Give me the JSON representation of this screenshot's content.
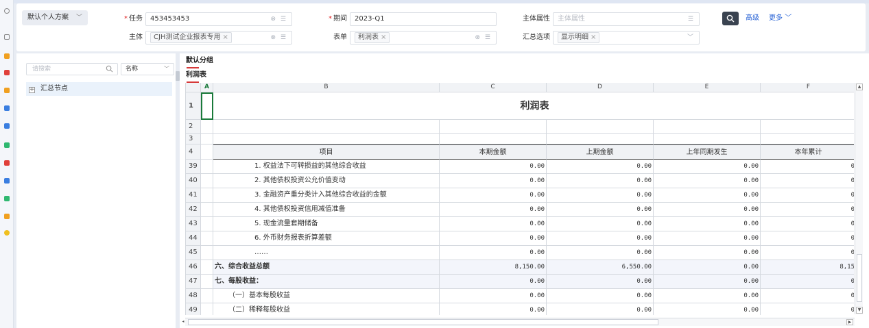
{
  "scheme": {
    "label": "默认个人方案"
  },
  "filters": {
    "task": {
      "label": "任务",
      "value": "453453453"
    },
    "period": {
      "label": "期间",
      "value": "2023-Q1"
    },
    "entity_attr": {
      "label": "主体属性",
      "placeholder": "主体属性"
    },
    "entity": {
      "label": "主体",
      "tag": "CJH测试企业报表专用"
    },
    "form": {
      "label": "表单",
      "tag": "利润表"
    },
    "summary": {
      "label": "汇总选项",
      "tag": "显示明细"
    }
  },
  "actions": {
    "advanced": "高级",
    "more": "更多"
  },
  "sidebar": {
    "search_placeholder": "请搜索",
    "select_value": "名称",
    "tree_root": "汇总节点"
  },
  "tabs": {
    "group": "默认分组",
    "sheet": "利润表"
  },
  "grid": {
    "columns": [
      "A",
      "B",
      "C",
      "D",
      "E",
      "F"
    ],
    "title": "利润表",
    "headers": [
      "项目",
      "本期金额",
      "上期金额",
      "上年同期发生",
      "本年累计"
    ],
    "top_rows": [
      "1",
      "2",
      "3",
      "4"
    ],
    "rows": [
      {
        "n": "39",
        "item": "1. 权益法下可转损益的其他综合收益",
        "c": "0.00",
        "d": "0.00",
        "e": "0.00",
        "f": "0"
      },
      {
        "n": "40",
        "item": "2. 其他债权投资公允价值变动",
        "c": "0.00",
        "d": "0.00",
        "e": "0.00",
        "f": "0"
      },
      {
        "n": "41",
        "item": "3. 金融资产重分类计入其他综合收益的金额",
        "c": "0.00",
        "d": "0.00",
        "e": "0.00",
        "f": "0"
      },
      {
        "n": "42",
        "item": "4. 其他债权投资信用减值准备",
        "c": "0.00",
        "d": "0.00",
        "e": "0.00",
        "f": "0"
      },
      {
        "n": "43",
        "item": "5. 现金流量套期储备",
        "c": "0.00",
        "d": "0.00",
        "e": "0.00",
        "f": "0"
      },
      {
        "n": "44",
        "item": "6. 外币财务报表折算差额",
        "c": "0.00",
        "d": "0.00",
        "e": "0.00",
        "f": "0"
      },
      {
        "n": "45",
        "item": "……",
        "c": "0.00",
        "d": "0.00",
        "e": "0.00",
        "f": "0"
      },
      {
        "n": "46",
        "item": "六、综合收益总额",
        "c": "8,150.00",
        "d": "6,550.00",
        "e": "0.00",
        "f": "8,15"
      },
      {
        "n": "47",
        "item": "七、每股收益：",
        "c": "0.00",
        "d": "0.00",
        "e": "0.00",
        "f": "0"
      },
      {
        "n": "48",
        "item": "（一）基本每股收益",
        "c": "0.00",
        "d": "0.00",
        "e": "0.00",
        "f": "0"
      },
      {
        "n": "49",
        "item": "（二）稀释每股收益",
        "c": "0.00",
        "d": "0.00",
        "e": "0.00",
        "f": "0"
      }
    ]
  },
  "colors": {
    "accent": "#2a64d6",
    "required": "#e02020",
    "tab_underline": "#d63a3a",
    "selected_node": "#eaf2fb"
  }
}
